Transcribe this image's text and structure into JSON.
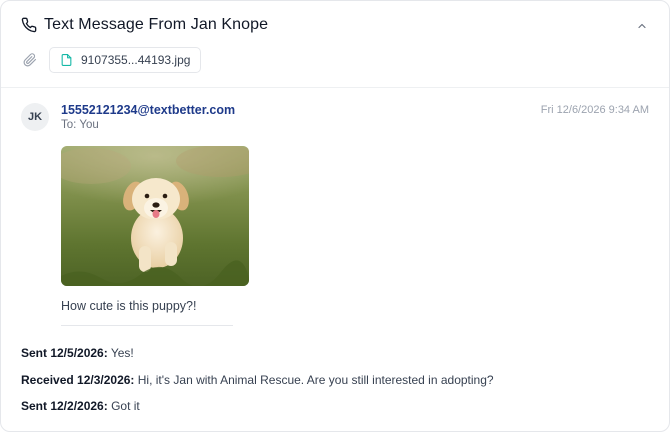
{
  "header": {
    "title": "Text Message From Jan Knope",
    "phone_icon": "phone-icon",
    "collapse_icon": "chevron-up-icon"
  },
  "attachments": {
    "icon": "paperclip-icon",
    "files": [
      {
        "name": "9107355...44193.jpg",
        "icon": "file-icon"
      }
    ]
  },
  "message": {
    "avatar_initials": "JK",
    "sender": "15552121234@textbetter.com",
    "to": "To: You",
    "timestamp": "Fri 12/6/2026 9:34 AM",
    "image": "puppy-photo",
    "body": "How cute is this puppy?!"
  },
  "history": [
    {
      "label": "Sent 12/5/2026:",
      "text": "Yes!"
    },
    {
      "label": "Received 12/3/2026:",
      "text": "Hi, it's Jan with Animal Rescue. Are you still interested in adopting?"
    },
    {
      "label": "Sent 12/2/2026:",
      "text": "Got it"
    }
  ],
  "colors": {
    "sender_link": "#1e3a8a",
    "file_icon": "#14b8a6",
    "border": "#e5e7eb"
  }
}
